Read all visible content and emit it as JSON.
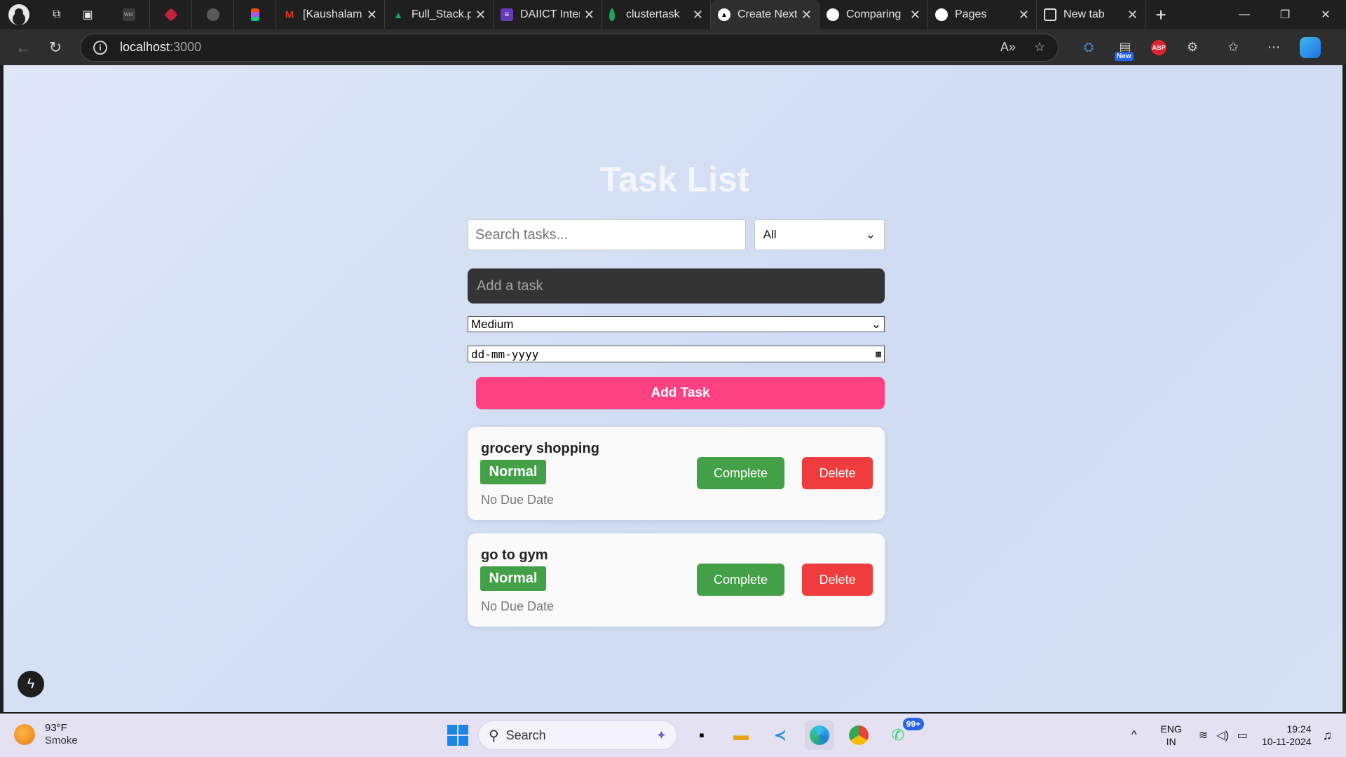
{
  "browser": {
    "pinned_tabs": [
      {
        "icon": "wix-icon",
        "label": "WIX",
        "color": "#3d3d3d"
      },
      {
        "icon": "ruby-icon",
        "label": "",
        "color": "#c0233a"
      },
      {
        "icon": "bug-icon",
        "label": "",
        "color": "#5a5a5a"
      },
      {
        "icon": "figma-icon",
        "label": "",
        "color": "#f24e1e"
      }
    ],
    "tabs": [
      {
        "title": "[Kaushalam",
        "icon": "gmail-icon",
        "fav_color": "#d93025",
        "fav_text": "M",
        "active": false
      },
      {
        "title": "Full_Stack.p",
        "icon": "google-drive-icon",
        "fav_color": "#1fa463",
        "fav_text": "▲",
        "active": false
      },
      {
        "title": "DAIICT Inter",
        "icon": "form-icon",
        "fav_color": "#673ab7",
        "fav_text": "≡",
        "active": false
      },
      {
        "title": "clustertask",
        "icon": "mongodb-leaf-icon",
        "fav_color": "#13aa52",
        "fav_text": "",
        "active": false
      },
      {
        "title": "Create Next",
        "icon": "vercel-icon",
        "fav_color": "#000000",
        "fav_text": "▲",
        "active": true
      },
      {
        "title": "Comparing",
        "icon": "github-icon",
        "fav_color": "#ffffff",
        "fav_text": "",
        "active": false
      },
      {
        "title": "Pages",
        "icon": "github-icon",
        "fav_color": "#ffffff",
        "fav_text": "",
        "active": false
      },
      {
        "title": "New tab",
        "icon": "new-tab-icon",
        "fav_color": "#2e2e2e",
        "fav_text": "",
        "active": false
      }
    ],
    "address": {
      "host": "localhost",
      "port": ":3000"
    },
    "extension_new_badge": "New",
    "extension_abp": "ABP"
  },
  "app": {
    "title": "Task List",
    "search_placeholder": "Search tasks...",
    "filter_value": "All",
    "task_placeholder": "Add a task",
    "priority_value": "Medium",
    "date_placeholder": "dd-mm-yyyy",
    "add_button": "Add Task",
    "tasks": [
      {
        "title": "grocery shopping",
        "priority": "Normal",
        "due": "No Due Date",
        "complete_label": "Complete",
        "delete_label": "Delete"
      },
      {
        "title": "go to gym",
        "priority": "Normal",
        "due": "No Due Date",
        "complete_label": "Complete",
        "delete_label": "Delete"
      }
    ],
    "colors": {
      "accent": "#ff4081",
      "complete": "#43a047",
      "delete": "#f03c3c",
      "badge": "#43a047"
    }
  },
  "taskbar": {
    "weather_temp": "93°F",
    "weather_desc": "Smoke",
    "search_label": "Search",
    "whatsapp_badge": "99+",
    "lang_top": "ENG",
    "lang_bottom": "IN",
    "time": "19:24",
    "date": "10-11-2024"
  }
}
